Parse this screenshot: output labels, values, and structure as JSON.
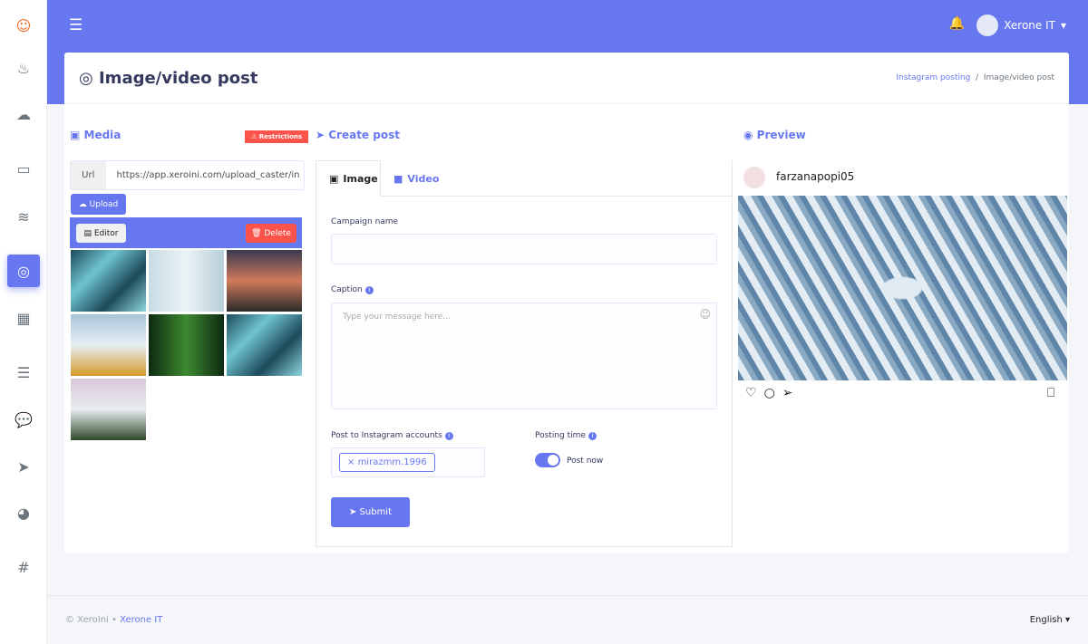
{
  "sidebar": {
    "items": [
      {
        "icon": "logo-icon"
      },
      {
        "icon": "fire-icon"
      },
      {
        "icon": "cloud-download-icon"
      },
      {
        "icon": "laptop-code-icon"
      },
      {
        "icon": "coins-icon"
      },
      {
        "icon": "instagram-icon",
        "active": true
      },
      {
        "icon": "calendar-icon"
      },
      {
        "icon": "rss-list-icon"
      },
      {
        "icon": "comment-icon"
      },
      {
        "icon": "paper-plane-icon"
      },
      {
        "icon": "pie-chart-icon"
      },
      {
        "icon": "hashtag-icon"
      }
    ]
  },
  "topbar": {
    "user": "Xerone IT"
  },
  "header": {
    "title": "Image/video post",
    "breadcrumb": [
      "Instagram posting",
      "Image/video post"
    ]
  },
  "media": {
    "title": "Media",
    "restrictions": "Restrictions",
    "url_label": "Url",
    "url_value": "https://app.xeroini.com/upload_caster/in",
    "upload": "Upload",
    "editor": "Editor",
    "delete": "Delete"
  },
  "create": {
    "title": "Create post",
    "tabs": [
      "Image",
      "Video"
    ],
    "campaign_label": "Campaign name",
    "campaign_value": "",
    "caption_label": "Caption",
    "caption_placeholder": "Type your message here...",
    "accounts_label": "Post to Instagram accounts",
    "account_tag": "mirazmm.1996",
    "posting_label": "Posting time",
    "post_now": "Post now",
    "post_now_on": true,
    "submit": "Submit"
  },
  "preview": {
    "title": "Preview",
    "username": "farzanapopi05"
  },
  "footer": {
    "copyright": "© XeroIni",
    "company": "Xerone IT",
    "language": "English"
  },
  "colors": {
    "primary": "#6777ef",
    "danger": "#fc544b"
  }
}
